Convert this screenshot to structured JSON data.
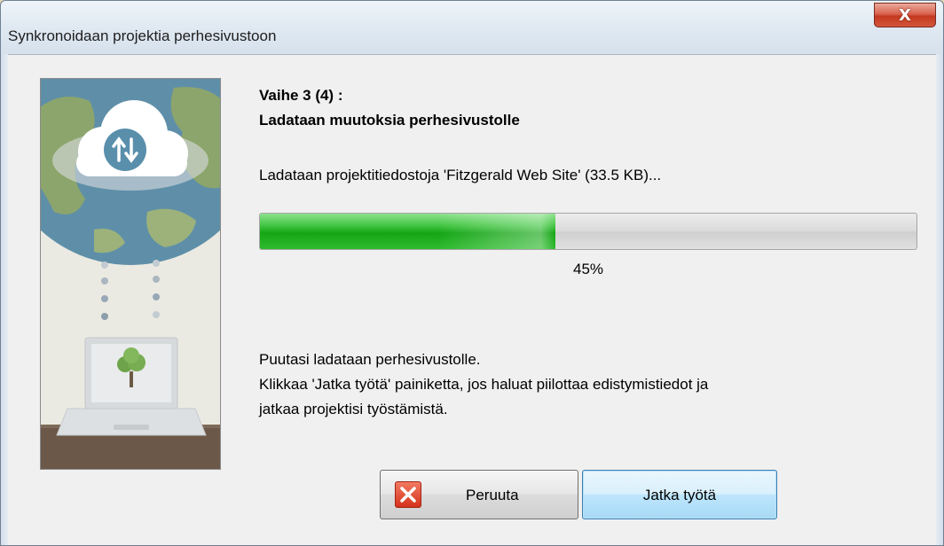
{
  "window": {
    "title": "Synkronoidaan projektia perhesivustoon",
    "close_label": "X"
  },
  "step": {
    "heading": "Vaihe 3 (4) :",
    "subheading": "Ladataan muutoksia perhesivustolle"
  },
  "status": {
    "text": "Ladataan projektitiedostoja 'Fitzgerald Web Site' (33.5 KB)..."
  },
  "progress": {
    "value": 0.45,
    "label": "45%",
    "fill_color": "#1faf1f"
  },
  "info": {
    "line1": "Puutasi ladataan perhesivustolle.",
    "line2": "Klikkaa 'Jatka työtä' painiketta, jos haluat piilottaa edistymistiedot ja",
    "line3": "jatkaa projektisi työstämistä."
  },
  "buttons": {
    "cancel_label": "Peruuta",
    "cancel_icon": "red-x-icon",
    "continue_label": "Jatka työtä"
  },
  "illustration": {
    "icons": [
      "cloud-sync-icon",
      "globe",
      "laptop-icon",
      "tree-icon"
    ]
  }
}
